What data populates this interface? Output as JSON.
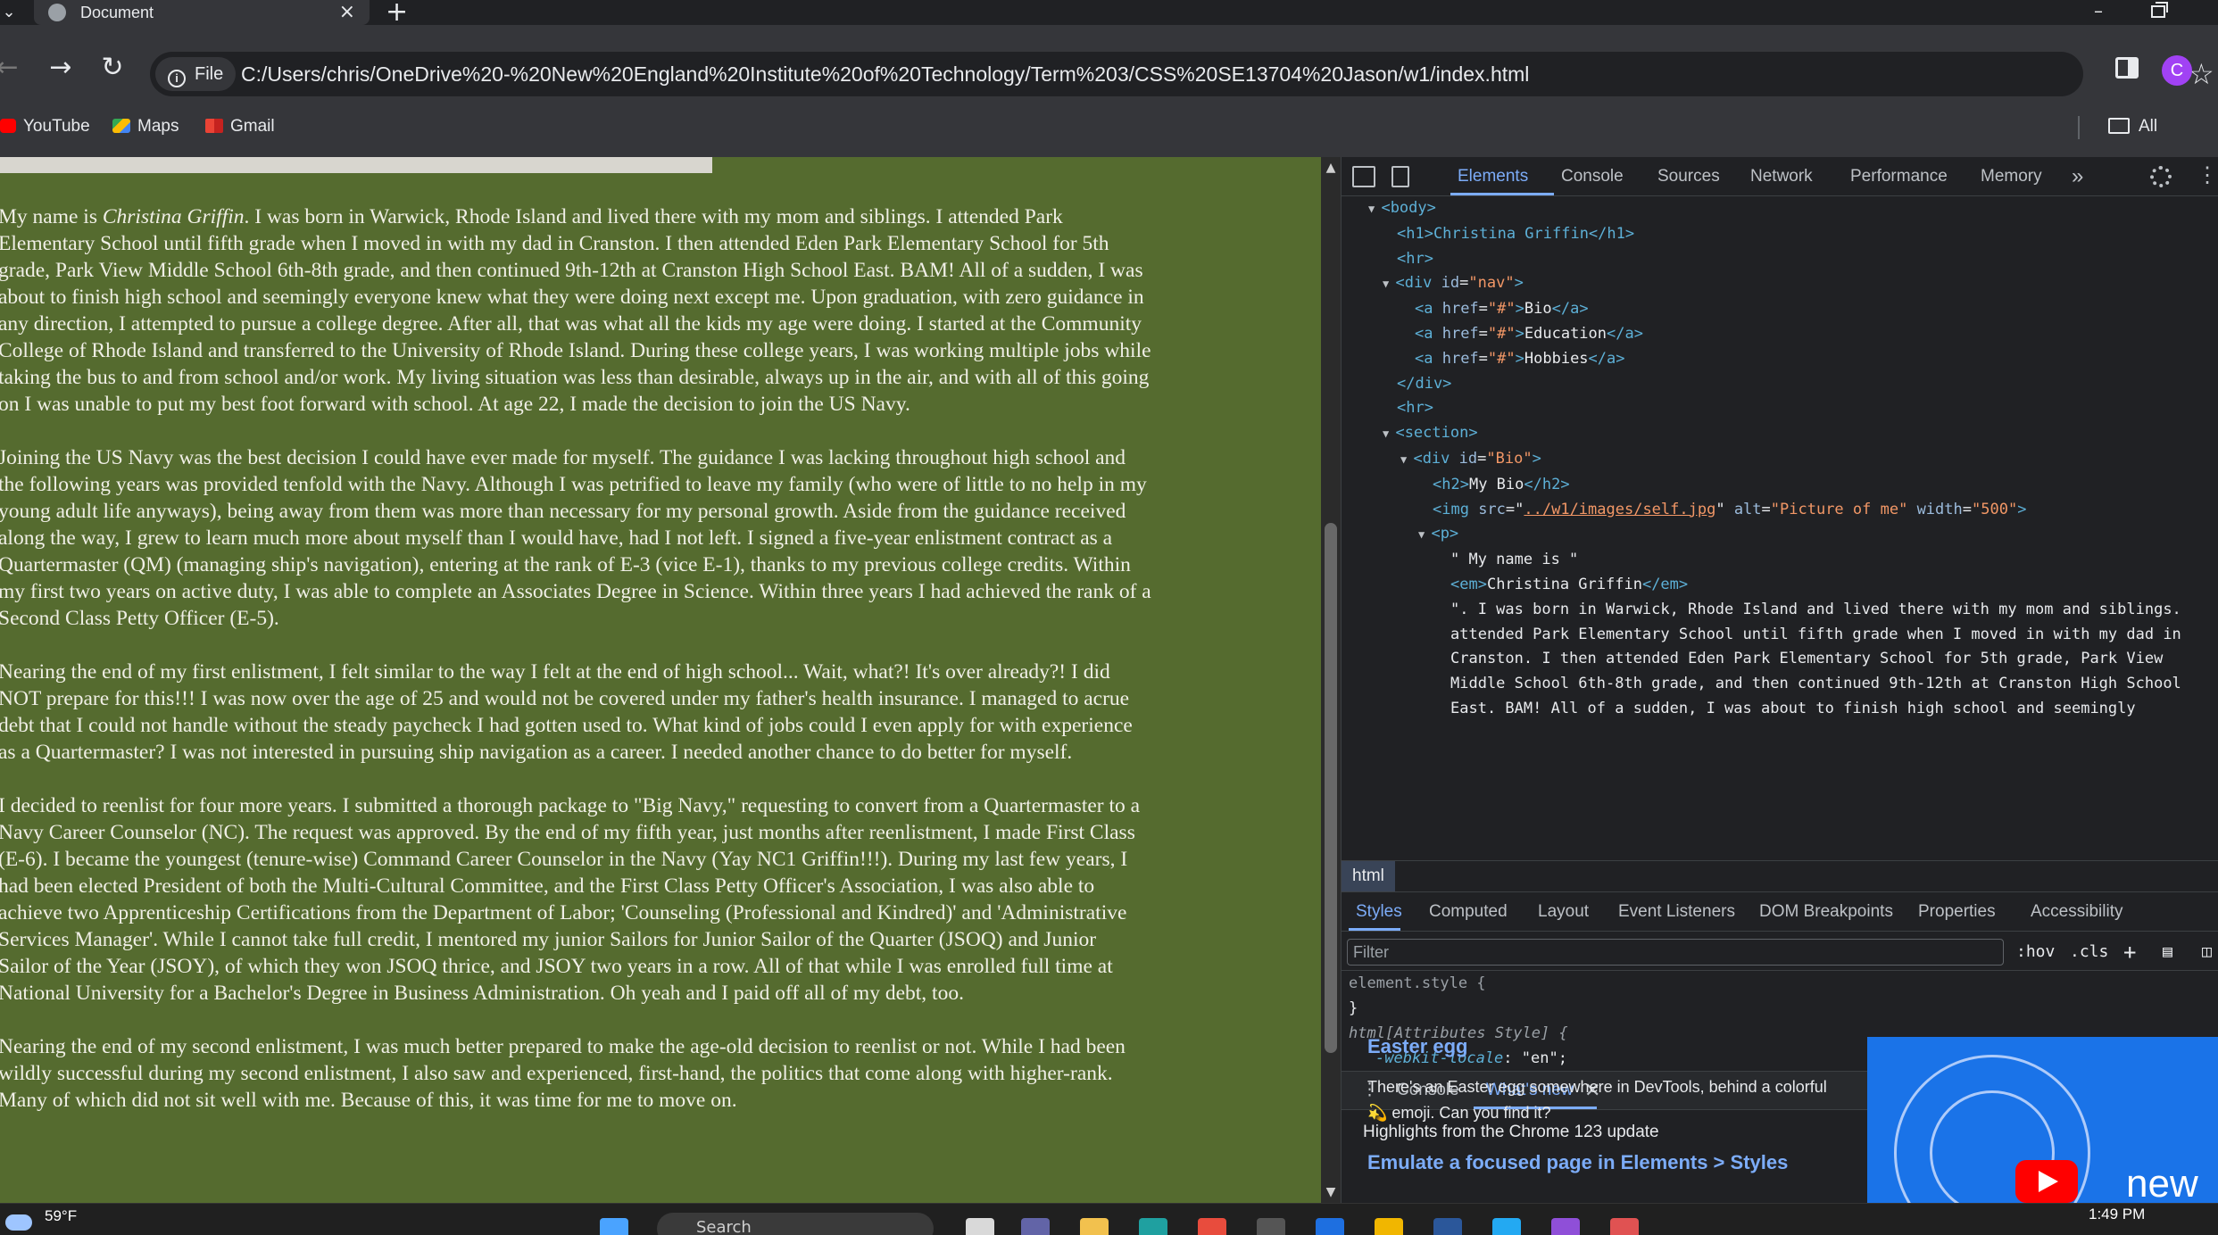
{
  "browser": {
    "tab_title": "Document",
    "new_tab": "+",
    "close_tab": "×",
    "minimize": "–",
    "file_chip": "File",
    "url": "C:/Users/chris/OneDrive%20-%20New%20England%20Institute%20of%20Technology/Term%203/CSS%20SE13704%20Jason/w1/index.html",
    "avatar_letter": "C",
    "back": "←",
    "forward": "→",
    "reload": "↻",
    "star": "☆"
  },
  "bookmarks": {
    "items": [
      "YouTube",
      "Maps",
      "Gmail"
    ],
    "all_bookmarks": "All Bookma"
  },
  "page": {
    "background": "#556b2f",
    "intro_before_em": "My name is ",
    "intro_em": "Christina Griffin",
    "paragraph1": ". I was born in Warwick, Rhode Island and lived there with my mom and siblings. I attended Park Elementary School until fifth grade when I moved in with my dad in Cranston. I then attended Eden Park Elementary School for 5th grade, Park View Middle School 6th-8th grade, and then continued 9th-12th at Cranston High School East. BAM! All of a sudden, I was about to finish high school and seemingly everyone knew what they were doing next except me. Upon graduation, with zero guidance in any direction, I attempted to pursue a college degree. After all, that was what all the kids my age were doing. I started at the Community College of Rhode Island and transferred to the University of Rhode Island. During these college years, I was working multiple jobs while taking the bus to and from school and/or work. My living situation was less than desirable, always up in the air, and with all of this going on I was unable to put my best foot forward with school. At age 22, I made the decision to join the US Navy.",
    "paragraph2": "Joining the US Navy was the best decision I could have ever made for myself. The guidance I was lacking throughout high school and the following years was provided tenfold with the Navy. Although I was petrified to leave my family (who were of little to no help in my young adult life anyways), being away from them was more than necessary for my personal growth. Aside from the guidance received along the way, I grew to learn much more about myself than I would have, had I not left. I signed a five-year enlistment contract as a Quartermaster (QM) (managing ship's navigation), entering at the rank of E-3 (vice E-1), thanks to my previous college credits. Within my first two years on active duty, I was able to complete an Associates Degree in Science. Within three years I had achieved the rank of a Second Class Petty Officer (E-5).",
    "paragraph3": "Nearing the end of my first enlistment, I felt similar to the way I felt at the end of high school... Wait, what?! It's over already?! I did NOT prepare for this!!! I was now over the age of 25 and would not be covered under my father's health insurance. I managed to acrue debt that I could not handle without the steady paycheck I had gotten used to. What kind of jobs could I even apply for with experience as a Quartermaster? I was not interested in pursuing ship navigation as a career. I needed another chance to do better for myself.",
    "paragraph4": "I decided to reenlist for four more years. I submitted a thorough package to \"Big Navy,\" requesting to convert from a Quartermaster to a Navy Career Counselor (NC). The request was approved. By the end of my fifth year, just months after reenlistment, I made First Class (E-6). I became the youngest (tenure-wise) Command Career Counselor in the Navy (Yay NC1 Griffin!!!). During my last few years, I had been elected President of both the Multi-Cultural Committee, and the First Class Petty Officer's Association, I was also able to achieve two Apprenticeship Certifications from the Department of Labor; 'Counseling (Professional and Kindred)' and 'Administrative Services Manager'. While I cannot take full credit, I mentored my junior Sailors for Junior Sailor of the Quarter (JSOQ) and Junior Sailor of the Year (JSOY), of which they won JSOQ thrice, and JSOY two years in a row. All of that while I was enrolled full time at National University for a Bachelor's Degree in Business Administration. Oh yeah and I paid off all of my debt, too.",
    "paragraph5": "Nearing the end of my second enlistment, I was much better prepared to make the age-old decision to reenlist or not. While I had been wildly successful during my second enlistment, I also saw and experienced, first-hand, the politics that come along with higher-rank. Many of which did not sit well with me. Because of this, it was time for me to move on."
  },
  "devtools": {
    "tabs": [
      "Elements",
      "Console",
      "Sources",
      "Network",
      "Performance",
      "Memory"
    ],
    "more_tabs": "»",
    "dom": {
      "body_open": "<body>",
      "h1": "<h1>Christina Griffin</h1>",
      "hr1": "<hr>",
      "nav_open_tag": "div",
      "nav_attr": "id",
      "nav_val": "\"nav\"",
      "link1_text": "Bio",
      "link2_text": "Education",
      "link3_text": "Hobbies",
      "href_val": "\"#\"",
      "div_close": "</div>",
      "hr2": "<hr>",
      "section_open": "<section>",
      "bio_div_val": "\"Bio\"",
      "h2_text": "My Bio",
      "img_src": "../w1/images/self.jpg",
      "img_alt": "\"Picture of me\"",
      "img_width": "\"500\"",
      "p_open": "<p>",
      "text1": "\" My name is \"",
      "em_text": "Christina Griffin",
      "text2a": "\". I was born in Warwick, Rhode Island and lived there with my mom and siblings.",
      "text2b": "attended Park Elementary School until fifth grade when I moved in with my dad in",
      "text2c": "Cranston. I then attended Eden Park Elementary School for 5th grade, Park View",
      "text2d": "Middle School 6th-8th grade, and then continued 9th-12th at Cranston High School",
      "text2e": "East. BAM! All of a sudden, I was about to finish high school and seemingly"
    },
    "breadcrumb": "html",
    "style_tabs": [
      "Styles",
      "Computed",
      "Layout",
      "Event Listeners",
      "DOM Breakpoints",
      "Properties",
      "Accessibility"
    ],
    "filter_placeholder": "Filter",
    "hov": ":hov",
    "cls": ".cls",
    "styles": {
      "element_style": "element.style {",
      "close_brace": "}",
      "attr_style": "html[Attributes Style] {",
      "locale_prop": "-webkit-locale",
      "locale_val": "\"en\";"
    },
    "drawer_tabs": [
      "Console",
      "What's new"
    ],
    "whats_new": {
      "heading": "Highlights from the Chrome 123 update",
      "title1": "Easter egg",
      "text1": "There's an Easter egg somewhere in DevTools, behind a colorful 💫 emoji. Can you find it?",
      "title2": "Emulate a focused page in Elements > Styles",
      "thumb_label": "new"
    }
  },
  "taskbar": {
    "weather": "59°F",
    "search": "Search",
    "time": "1:49 PM"
  }
}
